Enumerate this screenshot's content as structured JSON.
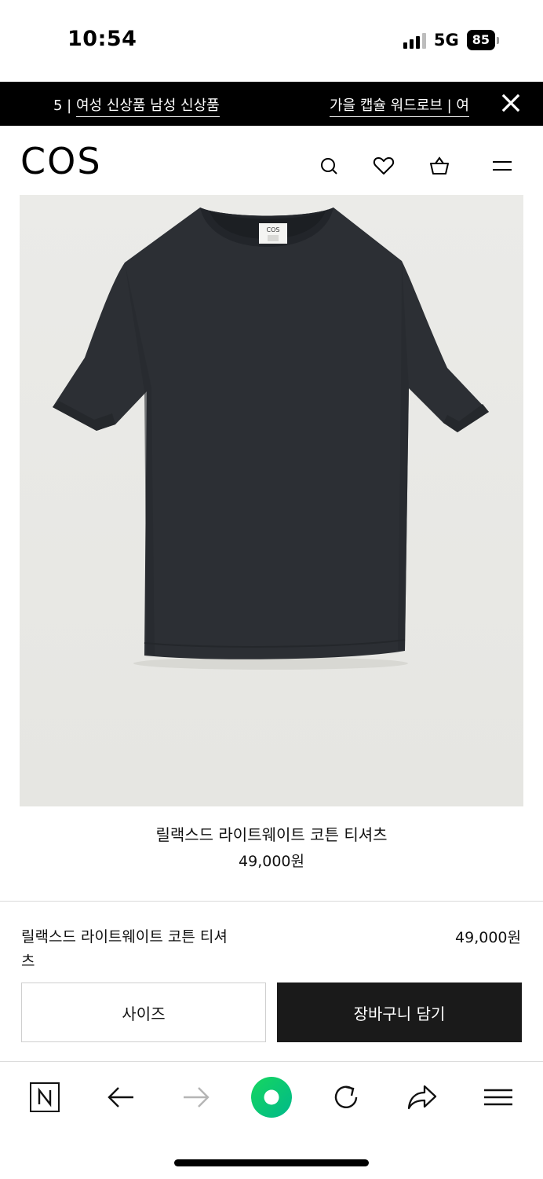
{
  "status_bar": {
    "time": "10:54",
    "network": "5G",
    "battery": "85"
  },
  "promo": {
    "left_prefix": "5 | ",
    "left_link": "여성 신상품 남성 신상품",
    "right_link": "가을 캡슐 워드로브 | 여"
  },
  "header": {
    "logo": "COS"
  },
  "product": {
    "label_text": "COS",
    "name": "릴랙스드 라이트웨이트 코튼 티셔츠",
    "price": "49,000원"
  },
  "summary": {
    "name": "릴랙스드 라이트웨이트 코튼 티셔츠",
    "price": "49,000원"
  },
  "actions": {
    "size_label": "사이즈",
    "cart_label": "장바구니 담기"
  },
  "colors": {
    "brand_black": "#000000",
    "cart_button": "#1a1a1a",
    "image_bg": "#e9e9e6",
    "shirt": "#2c2f34",
    "naver_green": "#03c75a"
  },
  "icons": [
    "search-icon",
    "heart-icon",
    "bag-icon",
    "menu-icon",
    "close-icon",
    "naver-n-icon",
    "back-arrow-icon",
    "forward-arrow-icon",
    "green-dot-icon",
    "reload-icon",
    "share-icon",
    "hamburger-icon"
  ]
}
